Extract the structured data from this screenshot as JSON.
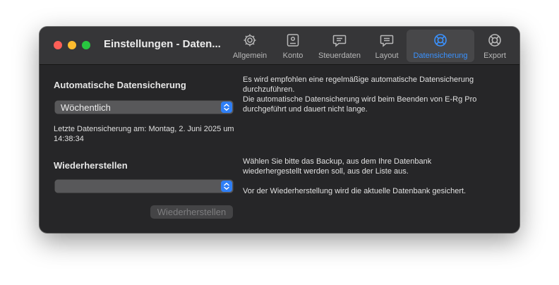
{
  "window": {
    "title": "Einstellungen - Daten...",
    "toolbar": [
      {
        "label": "Allgemein",
        "icon": "gear-icon"
      },
      {
        "label": "Konto",
        "icon": "account-card-icon"
      },
      {
        "label": "Steuerdaten",
        "icon": "speech-bubble-icon"
      },
      {
        "label": "Layout",
        "icon": "speech-bubble-lines-icon"
      },
      {
        "label": "Datensicherung",
        "icon": "lifebuoy-icon",
        "active": true
      },
      {
        "label": "Export",
        "icon": "lifebuoy-icon"
      }
    ]
  },
  "backup": {
    "title": "Automatische Datensicherung",
    "frequency": "Wöchentlich",
    "last_backup": "Letzte Datensicherung am: Montag, 2. Juni 2025 um 14:38:34",
    "info_line1": "Es wird empfohlen eine regelmäßige automatische Datensicherung durchzuführen.",
    "info_line2": "Die automatische Datensicherung wird beim Beenden von E-Rg Pro durchgeführt und dauert nicht lange."
  },
  "restore": {
    "title": "Wiederherstellen",
    "selection": "",
    "button_label": "Wiederherstellen",
    "info_line1": "Wählen Sie bitte das Backup, aus dem Ihre Datenbank wiederhergestellt werden soll, aus der Liste aus.",
    "info_line2": "Vor der Wiederherstellung wird die aktuelle Datenbank gesichert."
  },
  "colors": {
    "accent": "#3a92ff",
    "window_bg": "#262628",
    "titlebar_bg": "#363638",
    "close": "#fe5f57",
    "minimize": "#febc2e",
    "zoom": "#28c840"
  }
}
